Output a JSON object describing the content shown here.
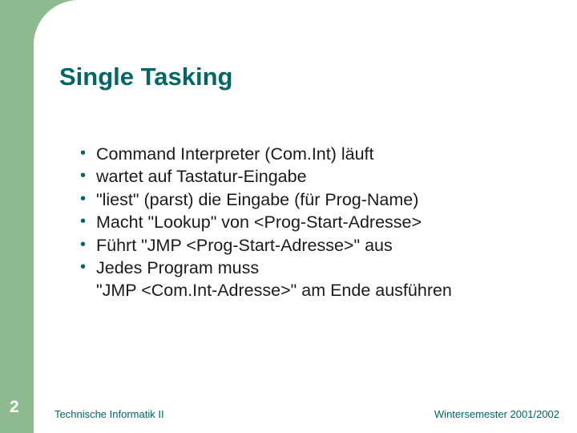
{
  "title": "Single Tasking",
  "bullets": [
    {
      "text": "Command Interpreter (Com.Int) läuft"
    },
    {
      "text": "wartet auf Tastatur-Eingabe"
    },
    {
      "text": "\"liest\" (parst) die Eingabe (für Prog-Name)"
    },
    {
      "text": "Macht \"Lookup\" von <Prog-Start-Adresse>"
    },
    {
      "text": "Führt  \"JMP <Prog-Start-Adresse>\" aus"
    },
    {
      "text": "Jedes Program muss",
      "cont": "\"JMP <Com.Int-Adresse>\" am Ende ausführen"
    }
  ],
  "footer": {
    "page_number": "2",
    "left": "Technische Informatik II",
    "right": "Wintersemester 2001/2002"
  }
}
